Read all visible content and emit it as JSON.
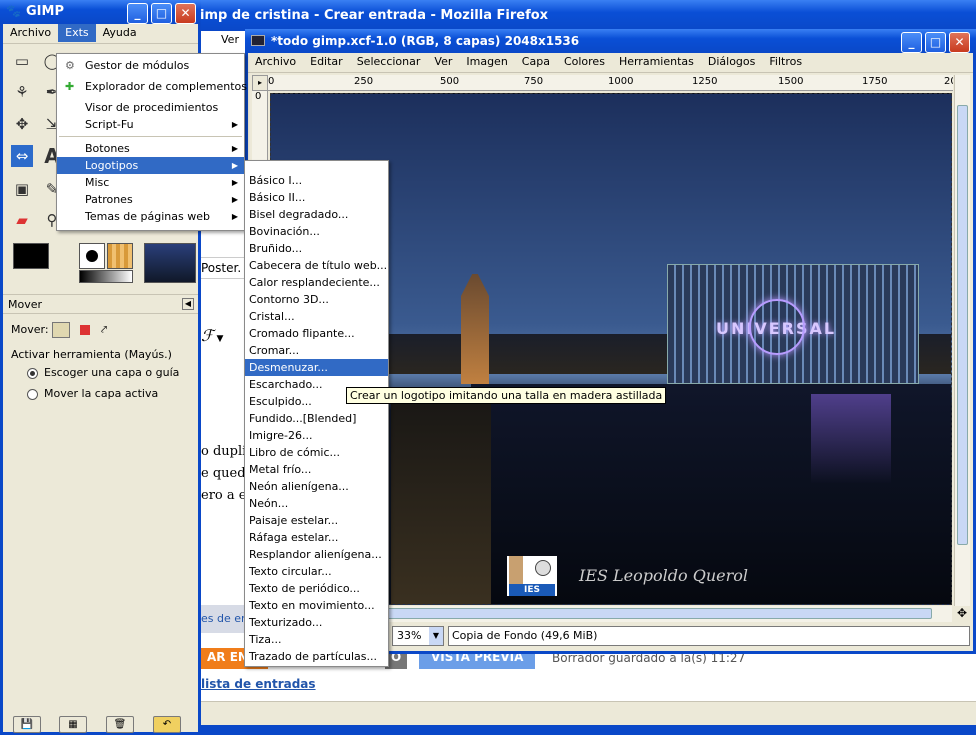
{
  "firefox": {
    "title": "imp de cristina - Crear entrada - Mozilla Firefox",
    "poster_fragment": "Poster.",
    "text_lines": [
      "o dupli",
      "e qued",
      "ero a e"
    ],
    "link_fragment": "es de en",
    "publish_label": "AR ENT",
    "draft_button_label": "O",
    "preview_label": "VISTA PREVIA",
    "autosave_text": "Borrador guardado a la(s) 11:27",
    "entries_link": "lista de entradas"
  },
  "gimp_main": {
    "title": "GIMP",
    "menu": [
      "Archivo",
      "Exts",
      "Ayuda"
    ],
    "behind_menu": [
      "Ver"
    ],
    "tool_options": {
      "title": "Mover",
      "mode_label": "Mover:",
      "activate_label": "Activar herramienta  (Mayús.)",
      "radio_options": [
        "Escoger una capa o guía",
        "Mover la capa activa"
      ],
      "selected_radio": "Escoger una capa o guía"
    }
  },
  "exts_menu": {
    "items": [
      {
        "label": "Gestor de módulos",
        "icon": "plug-icon",
        "submenu": false
      },
      {
        "label": "Explorador de complementos",
        "icon": "puzzle-icon",
        "submenu": false
      },
      {
        "label": "Visor de procedimientos",
        "icon": "",
        "submenu": false
      },
      {
        "label": "Script-Fu",
        "icon": "",
        "submenu": true
      },
      {
        "label": "Botones",
        "icon": "",
        "submenu": true
      },
      {
        "label": "Logotipos",
        "icon": "",
        "submenu": true,
        "highlighted": true
      },
      {
        "label": "Misc",
        "icon": "",
        "submenu": true
      },
      {
        "label": "Patrones",
        "icon": "",
        "submenu": true
      },
      {
        "label": "Temas de páginas web",
        "icon": "",
        "submenu": true
      }
    ]
  },
  "logos_submenu": {
    "items": [
      "Básico I...",
      "Básico II...",
      "Bisel degradado...",
      "Bovinación...",
      "Bruñido...",
      "Cabecera de título web...",
      "Calor resplandeciente...",
      "Contorno 3D...",
      "Cristal...",
      "Cromado flipante...",
      "Cromar...",
      "Desmenuzar...",
      "Escarchado...",
      "Esculpido...",
      "Fundido...[Blended]",
      "Imigre-26...",
      "Libro de cómic...",
      "Metal frío...",
      "Neón alienígena...",
      "Neón...",
      "Paisaje estelar...",
      "Ráfaga estelar...",
      "Resplandor alienígena...",
      "Texto circular...",
      "Texto de periódico...",
      "Texto en movimiento...",
      "Texturizado...",
      "Tiza...",
      "Trazado de partículas..."
    ],
    "highlighted": "Desmenuzar...",
    "tooltip": "Crear un logotipo imitando una talla en madera astillada"
  },
  "image_window": {
    "title": "*todo gimp.xcf-1.0 (RGB, 8 capas) 2048x1536",
    "menu": [
      "Archivo",
      "Editar",
      "Seleccionar",
      "Ver",
      "Imagen",
      "Capa",
      "Colores",
      "Herramientas",
      "Diálogos",
      "Filtros"
    ],
    "ruler_labels": [
      "0",
      "250",
      "500",
      "750",
      "1000",
      "1250",
      "1500",
      "1750",
      "20"
    ],
    "vruler_label": "0",
    "zoom": "33%",
    "status": "Copia de Fondo (49,6 MiB)",
    "image_texts": {
      "building_sign": "UNIVERSAL",
      "caption": "IES Leopoldo Querol",
      "logo_text": "IES"
    }
  },
  "colors": {
    "xp_blue": "#0a4fd6",
    "menu_highlight": "#316ac5",
    "gimp_panel": "#ece9d8",
    "sky_top": "#243a66",
    "water": "#0c1220",
    "neon_purple": "#b89cff"
  }
}
